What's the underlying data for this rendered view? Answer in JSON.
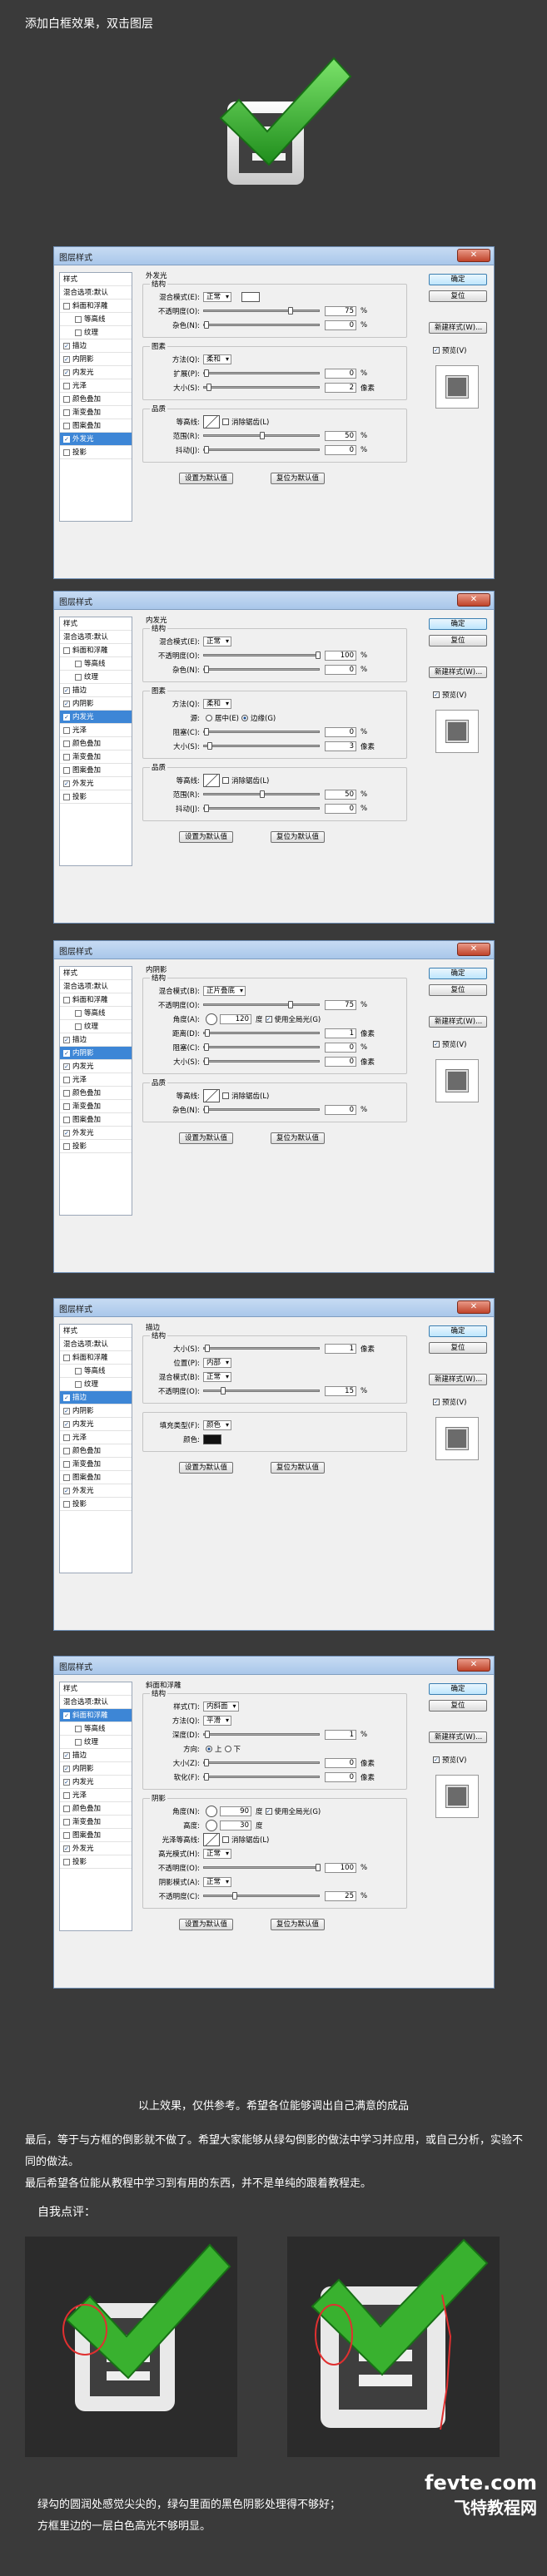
{
  "intro": "添加白框效果，双击图层",
  "common": {
    "title": "图层样式",
    "ok": "确定",
    "reset": "复位",
    "new_style": "新建样式(W)...",
    "preview": "预览(V)",
    "set_default": "设置为默认值",
    "reset_default": "复位为默认值",
    "blend_options": "混合选项:默认",
    "styles_header": "样式"
  },
  "style_labels": [
    "斜面和浮雕",
    "等高线",
    "纹理",
    "描边",
    "内阴影",
    "内发光",
    "光泽",
    "颜色叠加",
    "渐变叠加",
    "图案叠加",
    "外发光",
    "投影"
  ],
  "dialogs": [
    {
      "panel_title": "外发光",
      "checked": [
        3,
        4,
        5,
        10
      ],
      "selected": 10,
      "groups": [
        {
          "legend": "结构",
          "rows": [
            {
              "label": "混合模式(E):",
              "select": "正常"
            },
            {
              "label": "不透明度(O):",
              "slider": 75,
              "value": "75",
              "unit": "%"
            },
            {
              "label": "杂色(N):",
              "slider": 0,
              "value": "0",
              "unit": "%"
            }
          ]
        },
        {
          "legend": "图素",
          "rows": [
            {
              "label": "方法(Q):",
              "select": "柔和"
            },
            {
              "label": "扩展(P):",
              "slider": 0,
              "value": "0",
              "unit": "%"
            },
            {
              "label": "大小(S):",
              "slider": 2,
              "value": "2",
              "unit": "像素"
            }
          ]
        },
        {
          "legend": "品质",
          "rows": [
            {
              "label": "等高线:",
              "contour": true,
              "aa": "消除锯齿(L)"
            },
            {
              "label": "范围(R):",
              "slider": 50,
              "value": "50",
              "unit": "%"
            },
            {
              "label": "抖动(J):",
              "slider": 0,
              "value": "0",
              "unit": "%"
            }
          ]
        }
      ]
    },
    {
      "panel_title": "内发光",
      "checked": [
        3,
        4,
        5,
        10
      ],
      "selected": 5,
      "groups": [
        {
          "legend": "结构",
          "rows": [
            {
              "label": "混合模式(E):",
              "select": "正常"
            },
            {
              "label": "不透明度(O):",
              "slider": 100,
              "value": "100",
              "unit": "%"
            },
            {
              "label": "杂色(N):",
              "slider": 0,
              "value": "0",
              "unit": "%"
            }
          ]
        },
        {
          "legend": "图素",
          "rows": [
            {
              "label": "方法(Q):",
              "select": "柔和"
            },
            {
              "label": "源:",
              "source": [
                "居中(E)",
                "边缘(G)"
              ]
            },
            {
              "label": "阻塞(C):",
              "slider": 0,
              "value": "0",
              "unit": "%"
            },
            {
              "label": "大小(S):",
              "slider": 3,
              "value": "3",
              "unit": "像素"
            }
          ]
        },
        {
          "legend": "品质",
          "rows": [
            {
              "label": "等高线:",
              "contour": true,
              "aa": "消除锯齿(L)"
            },
            {
              "label": "范围(R):",
              "slider": 50,
              "value": "50",
              "unit": "%"
            },
            {
              "label": "抖动(J):",
              "slider": 0,
              "value": "0",
              "unit": "%"
            }
          ]
        }
      ]
    },
    {
      "panel_title": "内阴影",
      "checked": [
        3,
        4,
        5,
        10
      ],
      "selected": 4,
      "groups": [
        {
          "legend": "结构",
          "rows": [
            {
              "label": "混合模式(B):",
              "select": "正片叠底"
            },
            {
              "label": "不透明度(O):",
              "slider": 75,
              "value": "75",
              "unit": "%"
            },
            {
              "label": "角度(A):",
              "angle": "120",
              "unit": "度",
              "global": "使用全局光(G)"
            },
            {
              "label": "距离(D):",
              "slider": 1,
              "value": "1",
              "unit": "像素"
            },
            {
              "label": "阻塞(C):",
              "slider": 0,
              "value": "0",
              "unit": "%"
            },
            {
              "label": "大小(S):",
              "slider": 0,
              "value": "0",
              "unit": "像素"
            }
          ]
        },
        {
          "legend": "品质",
          "rows": [
            {
              "label": "等高线:",
              "contour": true,
              "aa": "消除锯齿(L)"
            },
            {
              "label": "杂色(N):",
              "slider": 0,
              "value": "0",
              "unit": "%"
            }
          ]
        }
      ]
    },
    {
      "panel_title": "描边",
      "checked": [
        3,
        4,
        5,
        10
      ],
      "selected": 3,
      "groups": [
        {
          "legend": "结构",
          "rows": [
            {
              "label": "大小(S):",
              "slider": 1,
              "value": "1",
              "unit": "像素"
            },
            {
              "label": "位置(P):",
              "select": "内部"
            },
            {
              "label": "混合模式(B):",
              "select": "正常"
            },
            {
              "label": "不透明度(O):",
              "slider": 15,
              "value": "15",
              "unit": "%"
            }
          ]
        },
        {
          "legend": "",
          "rows": [
            {
              "label": "填充类型(F):",
              "select": "颜色"
            },
            {
              "label": "颜色:",
              "color": "#111111"
            }
          ]
        }
      ]
    },
    {
      "panel_title": "斜面和浮雕",
      "checked": [
        0,
        3,
        4,
        5,
        10
      ],
      "selected": 0,
      "groups": [
        {
          "legend": "结构",
          "rows": [
            {
              "label": "样式(T):",
              "select": "内斜面"
            },
            {
              "label": "方法(Q):",
              "select": "平滑"
            },
            {
              "label": "深度(D):",
              "slider": 1,
              "value": "1",
              "unit": "%"
            },
            {
              "label": "方向:",
              "source": [
                "上",
                "下"
              ]
            },
            {
              "label": "大小(Z):",
              "slider": 0,
              "value": "0",
              "unit": "像素"
            },
            {
              "label": "软化(F):",
              "slider": 0,
              "value": "0",
              "unit": "像素"
            }
          ]
        },
        {
          "legend": "阴影",
          "rows": [
            {
              "label": "角度(N):",
              "angle": "90",
              "unit": "度",
              "global": "使用全局光(G)"
            },
            {
              "label": "高度:",
              "angle": "30",
              "unit": "度"
            },
            {
              "label": "光泽等高线:",
              "contour": true,
              "aa": "消除锯齿(L)"
            },
            {
              "label": "高光模式(H):",
              "select": "正常"
            },
            {
              "label": "不透明度(O):",
              "slider": 100,
              "value": "100",
              "unit": "%"
            },
            {
              "label": "阴影模式(A):",
              "select": "正常"
            },
            {
              "label": "不透明度(C):",
              "slider": 25,
              "value": "25",
              "unit": "%"
            }
          ]
        }
      ]
    }
  ],
  "caption1": "以上效果，仅供参考。希望各位能够调出自己满意的成品",
  "para1": "最后，等于与方框的倒影就不做了。希望大家能够从绿勾倒影的做法中学习并应用，或自己分析，实验不同的做法。",
  "para2": "最后希望各位能从教程中学习到有用的东西，并不是单纯的跟着教程走。",
  "comment_title": "自我点评：",
  "footer_line1": "绿勾的圆润处感觉尖尖的，绿勾里面的黑色阴影处理得不够好；",
  "footer_line2": "方框里边的一层白色高光不够明显。",
  "watermark_site": "fevte.com",
  "watermark_name": "飞特教程网"
}
